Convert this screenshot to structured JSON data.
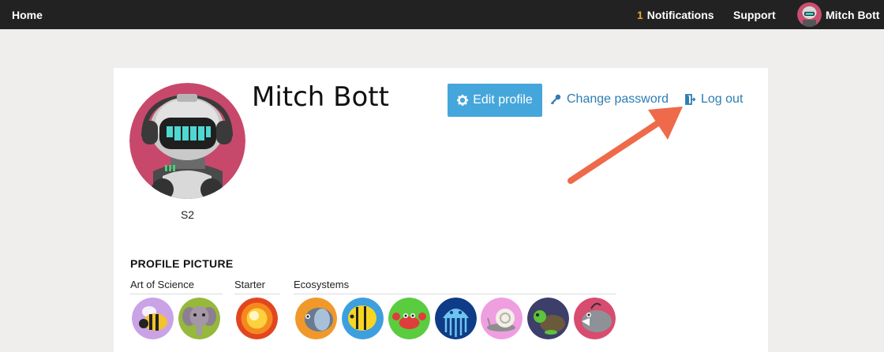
{
  "topbar": {
    "home": "Home",
    "notifications_count": "1",
    "notifications_label": "Notifications",
    "support": "Support",
    "user_name": "Mitch Bott"
  },
  "profile": {
    "name": "Mitch Bott",
    "level": "S2",
    "edit_profile": "Edit profile",
    "change_password": "Change password",
    "log_out": "Log out"
  },
  "picture_section": {
    "title": "PROFILE PICTURE",
    "groups": [
      {
        "label": "Art of Science",
        "pictures": [
          "bee-avatar-icon",
          "elephant-avatar-icon"
        ]
      },
      {
        "label": "Starter",
        "pictures": [
          "sun-avatar-icon"
        ]
      },
      {
        "label": "Ecosystems",
        "pictures": [
          "fish-avatar-icon",
          "butterflyfish-avatar-icon",
          "crab-avatar-icon",
          "jellyfish-avatar-icon",
          "snail-avatar-icon",
          "turtle-avatar-icon",
          "anglerfish-avatar-icon"
        ]
      }
    ]
  },
  "colors": {
    "topbar_bg": "#222222",
    "accent_button": "#45a6db",
    "link": "#2d7db3",
    "annotation_arrow": "#ee6a4a",
    "notif_count": "#e9a43a"
  }
}
